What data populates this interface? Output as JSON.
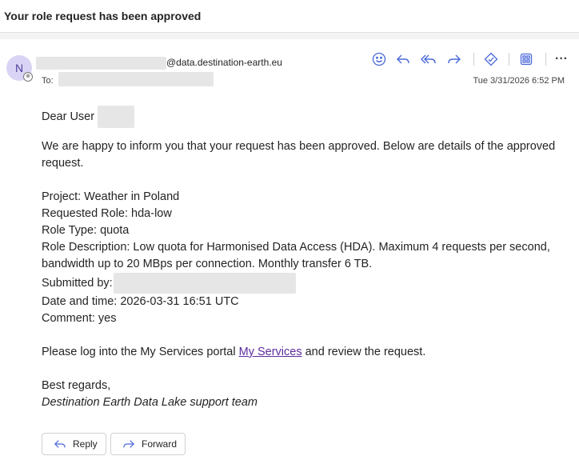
{
  "header": {
    "subject": "Your role request has been approved"
  },
  "sender": {
    "avatar_initial": "N",
    "email_domain": "@data.destination-earth.eu",
    "to_label": "To:",
    "date": "Tue 3/31/2026 6:52 PM"
  },
  "toolbar": {
    "icons": [
      "emoji-icon",
      "reply-icon",
      "reply-all-icon",
      "forward-icon",
      "tag-icon",
      "apps-icon",
      "more-icon"
    ]
  },
  "email": {
    "greeting": "Dear User",
    "intro": "We are happy to inform you that your request has been approved. Below are details of the approved request.",
    "project": "Project: Weather in Poland",
    "requested_role": "Requested Role: hda-low",
    "role_type": "Role Type: quota",
    "role_description": "Role Description: Low quota for Harmonised Data Access (HDA). Maximum 4 requests per second, bandwidth up to 20 MBps per connection. Monthly transfer 6 TB.",
    "submitted_by": "Submitted by:",
    "date_time": "Date and time: 2026-03-31 16:51 UTC",
    "comment": "Comment: yes",
    "portal_prefix": "Please log into the My Services portal ",
    "portal_link": "My Services",
    "portal_suffix": " and review the request.",
    "closing": "Best regards,",
    "signature": "Destination Earth Data Lake support team"
  },
  "actions": {
    "reply": "Reply",
    "forward": "Forward"
  },
  "colors": {
    "accent": "#4a68d8",
    "link": "#5b2ca0",
    "avatar_bg": "#d9d4f5"
  }
}
